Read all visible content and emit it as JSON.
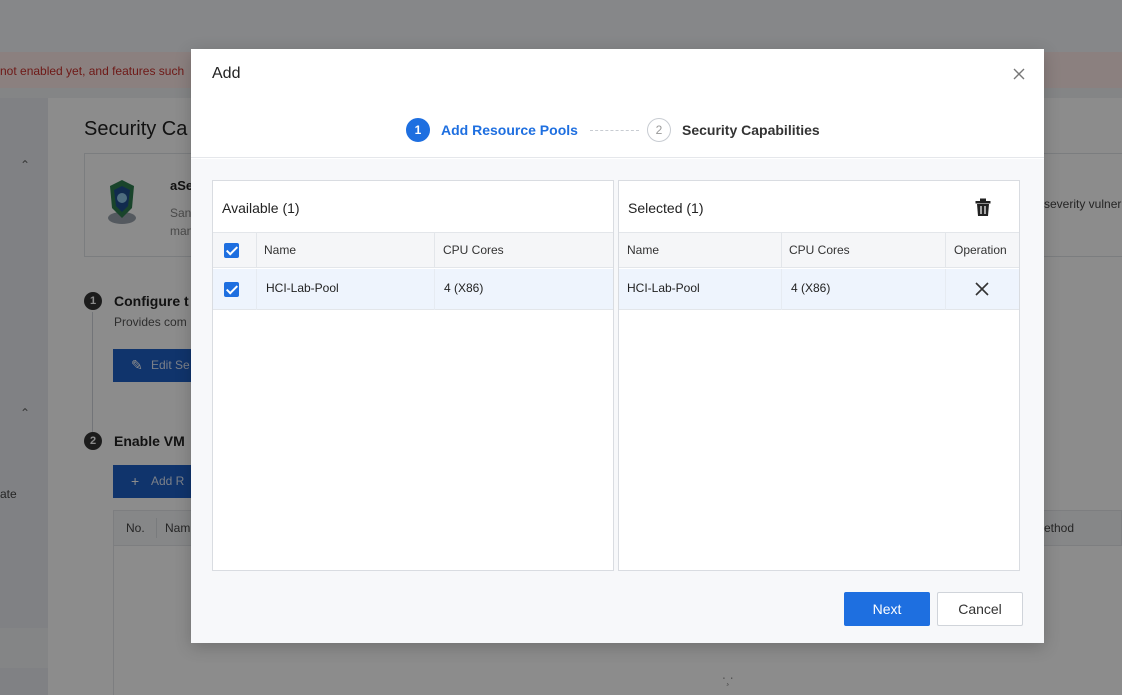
{
  "background": {
    "banner_text": "not enabled yet, and features such",
    "page_title": "Security Ca",
    "card": {
      "name": "aSe",
      "desc_line1": "San",
      "desc_line2": "man",
      "right_text": "severity vulner"
    },
    "step1": {
      "number": "1",
      "title": "Configure t",
      "desc": "Provides com",
      "button_label": "Edit Se"
    },
    "step2": {
      "number": "2",
      "title": "Enable VM",
      "button_label": "Add R"
    },
    "left_nav_label": "ate",
    "table": {
      "col_no": "No.",
      "col_name": "Nam",
      "col_method": "ethod"
    }
  },
  "modal": {
    "title": "Add",
    "steps": [
      {
        "number": "1",
        "label": "Add Resource Pools",
        "state": "active"
      },
      {
        "number": "2",
        "label": "Security Capabilities",
        "state": "idle"
      }
    ],
    "available": {
      "header": "Available (1)",
      "columns": {
        "name": "Name",
        "cpu": "CPU Cores"
      },
      "rows": [
        {
          "name": "HCI-Lab-Pool",
          "cpu": "4 (X86)",
          "checked": true
        }
      ]
    },
    "selected": {
      "header": "Selected (1)",
      "columns": {
        "name": "Name",
        "cpu": "CPU Cores",
        "operation": "Operation"
      },
      "rows": [
        {
          "name": "HCI-Lab-Pool",
          "cpu": "4 (X86)"
        }
      ]
    },
    "buttons": {
      "next": "Next",
      "cancel": "Cancel"
    }
  },
  "colors": {
    "accent": "#1e6fe0",
    "row_highlight": "#eef4fd",
    "banner": "#fde9e7"
  }
}
